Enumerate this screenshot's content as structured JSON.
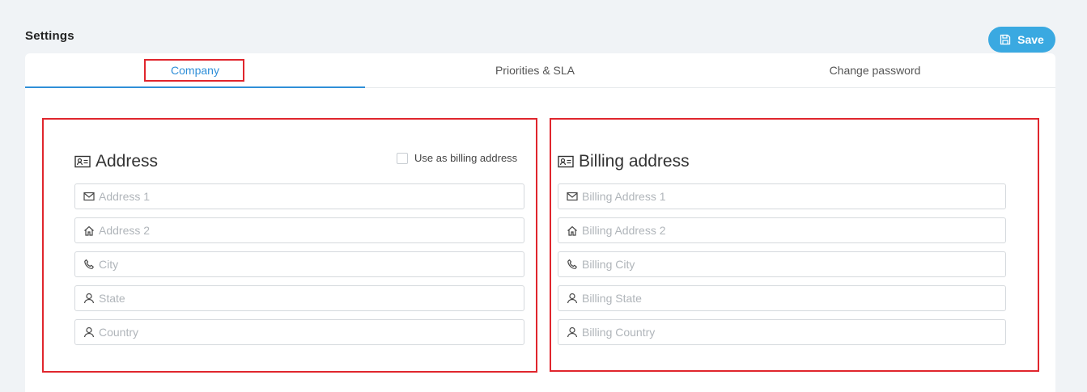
{
  "header": {
    "title": "Settings",
    "save_label": "Save"
  },
  "tabs": [
    {
      "label": "Company",
      "active": true
    },
    {
      "label": "Priorities & SLA",
      "active": false
    },
    {
      "label": "Change password",
      "active": false
    }
  ],
  "address": {
    "title": "Address",
    "use_billing_label": "Use as billing address",
    "use_billing_checked": false,
    "fields": [
      {
        "placeholder": "Address 1",
        "icon": "envelope-icon",
        "value": ""
      },
      {
        "placeholder": "Address 2",
        "icon": "home-icon",
        "value": ""
      },
      {
        "placeholder": "City",
        "icon": "phone-icon",
        "value": ""
      },
      {
        "placeholder": "State",
        "icon": "user-icon",
        "value": ""
      },
      {
        "placeholder": "Country",
        "icon": "user-icon",
        "value": ""
      }
    ]
  },
  "billing": {
    "title": "Billing address",
    "fields": [
      {
        "placeholder": "Billing Address 1",
        "icon": "envelope-icon",
        "value": ""
      },
      {
        "placeholder": "Billing Address 2",
        "icon": "home-icon",
        "value": ""
      },
      {
        "placeholder": "Billing City",
        "icon": "phone-icon",
        "value": ""
      },
      {
        "placeholder": "Billing State",
        "icon": "user-icon",
        "value": ""
      },
      {
        "placeholder": "Billing Country",
        "icon": "user-icon",
        "value": ""
      }
    ]
  },
  "colors": {
    "accent": "#3aa9e1",
    "active_tab": "#2f8fd8",
    "highlight": "#e0262d"
  }
}
